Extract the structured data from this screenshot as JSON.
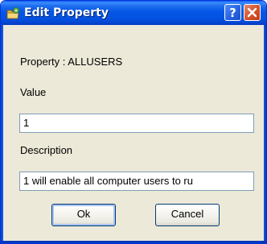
{
  "window": {
    "title": "Edit Property",
    "title_icon": "gear-folder-icon",
    "help_button_label": "?",
    "close_icon": "close-icon"
  },
  "form": {
    "property_label": "Property : ALLUSERS",
    "value_label": "Value",
    "value": "1",
    "description_label": "Description",
    "description_value": "1 will enable all computer users to ru"
  },
  "buttons": {
    "ok_label": "Ok",
    "cancel_label": "Cancel"
  },
  "colors": {
    "titlebar": "#0456e6",
    "dialog_background": "#ece9d8",
    "close_button": "#d6562e",
    "input_border": "#7f9db9"
  }
}
